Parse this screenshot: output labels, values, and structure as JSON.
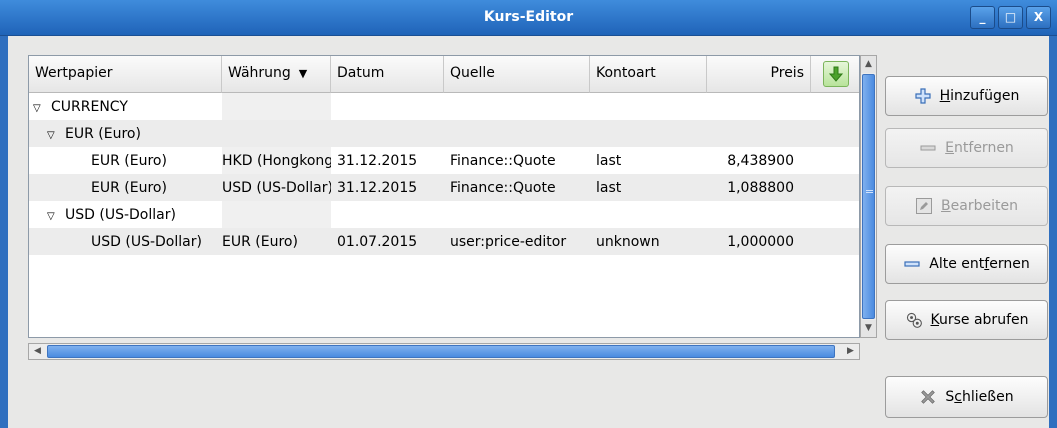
{
  "window": {
    "title": "Kurs-Editor"
  },
  "wm": {
    "minimize": "_",
    "maximize": "□",
    "close": "X"
  },
  "columns": {
    "security": "Wertpapier",
    "currency": "Währung",
    "date": "Datum",
    "source": "Quelle",
    "type": "Kontoart",
    "price": "Preis"
  },
  "rows": [
    {
      "security": "CURRENCY",
      "currency": "",
      "date": "",
      "source": "",
      "type": "",
      "price": ""
    },
    {
      "security": "EUR (Euro)",
      "currency": "",
      "date": "",
      "source": "",
      "type": "",
      "price": ""
    },
    {
      "security": "EUR (Euro)",
      "currency": "HKD (Hongkong-Dollar)",
      "date": "31.12.2015",
      "source": "Finance::Quote",
      "type": "last",
      "price": "8,438900"
    },
    {
      "security": "EUR (Euro)",
      "currency": "USD (US-Dollar)",
      "date": "31.12.2015",
      "source": "Finance::Quote",
      "type": "last",
      "price": "1,088800"
    },
    {
      "security": "USD (US-Dollar)",
      "currency": "",
      "date": "",
      "source": "",
      "type": "",
      "price": ""
    },
    {
      "security": "USD (US-Dollar)",
      "currency": "EUR (Euro)",
      "date": "01.07.2015",
      "source": "user:price-editor",
      "type": "unknown",
      "price": "1,000000"
    }
  ],
  "buttons": {
    "add": {
      "pre": "",
      "key": "H",
      "post": "inzufügen"
    },
    "remove": {
      "pre": "",
      "key": "E",
      "post": "ntfernen"
    },
    "edit": {
      "pre": "",
      "key": "B",
      "post": "earbeiten"
    },
    "remove_old": {
      "pre": "Alte ent",
      "key": "f",
      "post": "ernen"
    },
    "fetch": {
      "pre": "",
      "key": "K",
      "post": "urse abrufen"
    },
    "close": {
      "pre": "S",
      "key": "c",
      "post": "hließen"
    }
  },
  "icons": {
    "add": "plus-icon",
    "remove": "minus-icon",
    "edit": "edit-icon",
    "remove_old": "minus-icon",
    "fetch": "gears-icon",
    "close": "close-x-icon",
    "sort": "green-down-arrow-icon"
  },
  "colors": {
    "titlebar": "#2f6fbf",
    "selection_blue": "#4b8be0"
  }
}
